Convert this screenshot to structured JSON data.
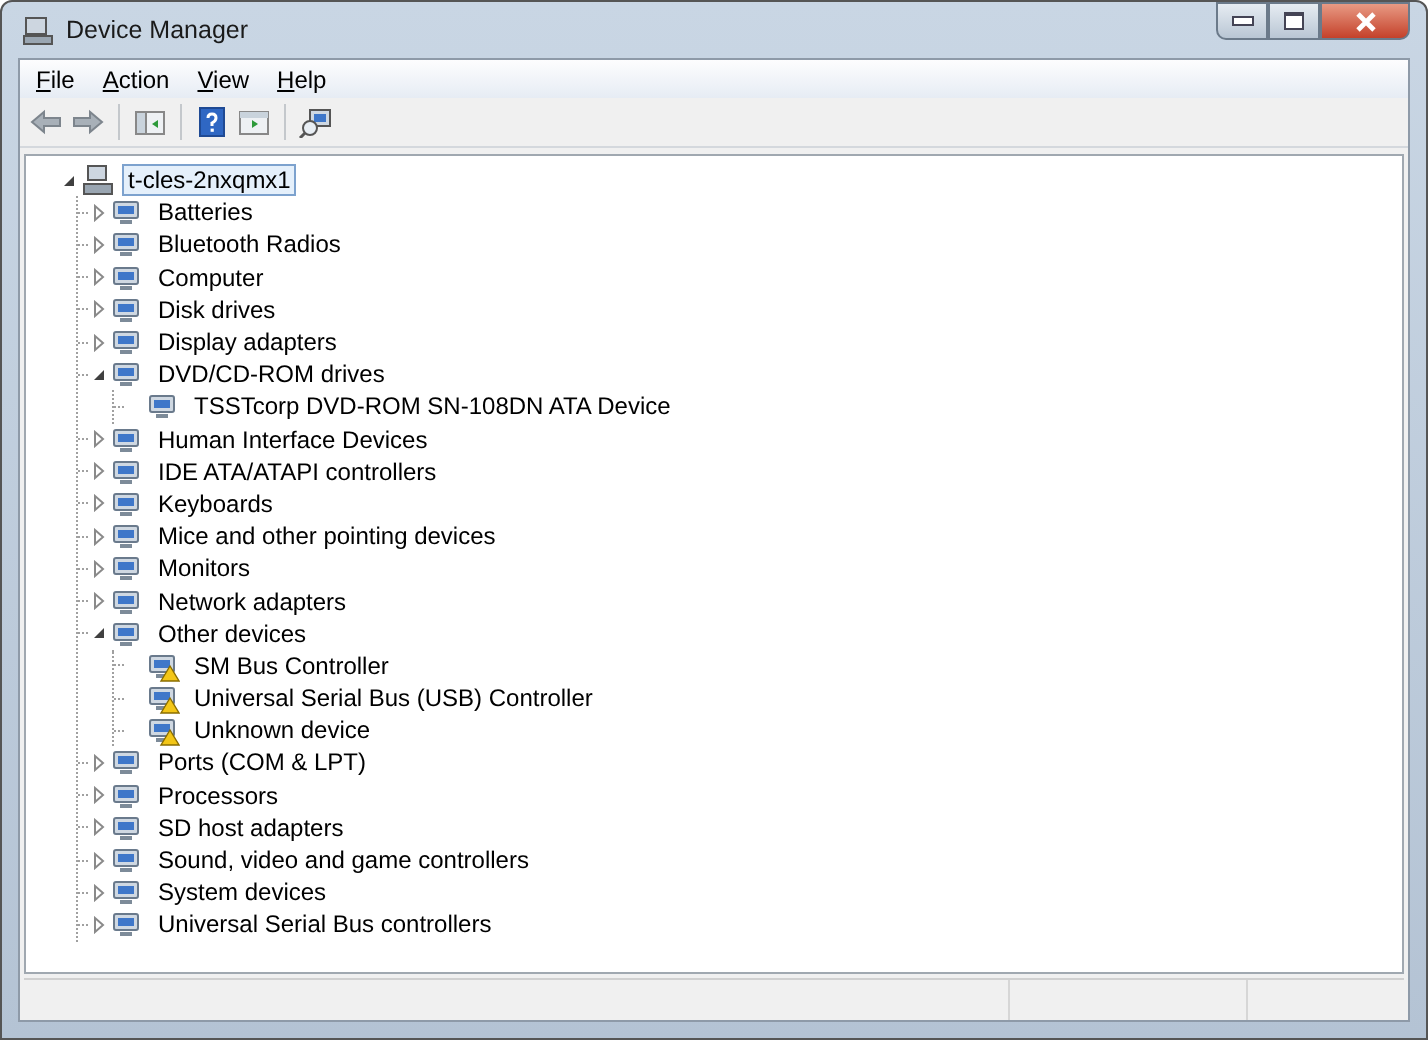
{
  "window": {
    "title": "Device Manager"
  },
  "menu": [
    "File",
    "Action",
    "View",
    "Help"
  ],
  "tree": {
    "label": "t-cles-2nxqmx1",
    "selected": true,
    "expanded": true,
    "children": [
      {
        "label": "Batteries",
        "expanded": false
      },
      {
        "label": "Bluetooth Radios",
        "expanded": false
      },
      {
        "label": "Computer",
        "expanded": false
      },
      {
        "label": "Disk drives",
        "expanded": false
      },
      {
        "label": "Display adapters",
        "expanded": false
      },
      {
        "label": "DVD/CD-ROM drives",
        "expanded": true,
        "children": [
          {
            "label": "TSSTcorp DVD-ROM SN-108DN ATA Device",
            "warning": false
          }
        ]
      },
      {
        "label": "Human Interface Devices",
        "expanded": false
      },
      {
        "label": "IDE ATA/ATAPI controllers",
        "expanded": false
      },
      {
        "label": "Keyboards",
        "expanded": false
      },
      {
        "label": "Mice and other pointing devices",
        "expanded": false
      },
      {
        "label": "Monitors",
        "expanded": false
      },
      {
        "label": "Network adapters",
        "expanded": false
      },
      {
        "label": "Other devices",
        "expanded": true,
        "children": [
          {
            "label": "SM Bus Controller",
            "warning": true
          },
          {
            "label": "Universal Serial Bus (USB) Controller",
            "warning": true
          },
          {
            "label": "Unknown device",
            "warning": true
          }
        ]
      },
      {
        "label": "Ports (COM & LPT)",
        "expanded": false
      },
      {
        "label": "Processors",
        "expanded": false
      },
      {
        "label": "SD host adapters",
        "expanded": false
      },
      {
        "label": "Sound, video and game controllers",
        "expanded": false
      },
      {
        "label": "System devices",
        "expanded": false
      },
      {
        "label": "Universal Serial Bus controllers",
        "expanded": false
      }
    ]
  }
}
